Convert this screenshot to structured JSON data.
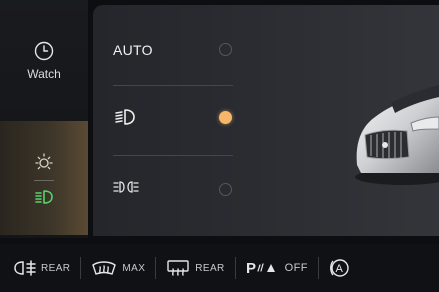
{
  "sidebar": {
    "watch_label": "Watch",
    "watch_icon": "clock-icon",
    "lights_icons": [
      "sun-icon",
      "headlight-icon"
    ]
  },
  "light_modes": [
    {
      "label": "AUTO",
      "selected": false
    },
    {
      "label": "",
      "icon": "low-beam-icon",
      "selected": true
    },
    {
      "label": "",
      "icon": "parking-lights-icon",
      "selected": false
    }
  ],
  "bottom_bar": {
    "rear_fog_label": "REAR",
    "front_defrost_label": "MAX",
    "rear_defrost_label": "REAR",
    "park_assist_label": "OFF"
  },
  "colors": {
    "accent": "#f6b66a",
    "active_green": "#57d46a"
  }
}
